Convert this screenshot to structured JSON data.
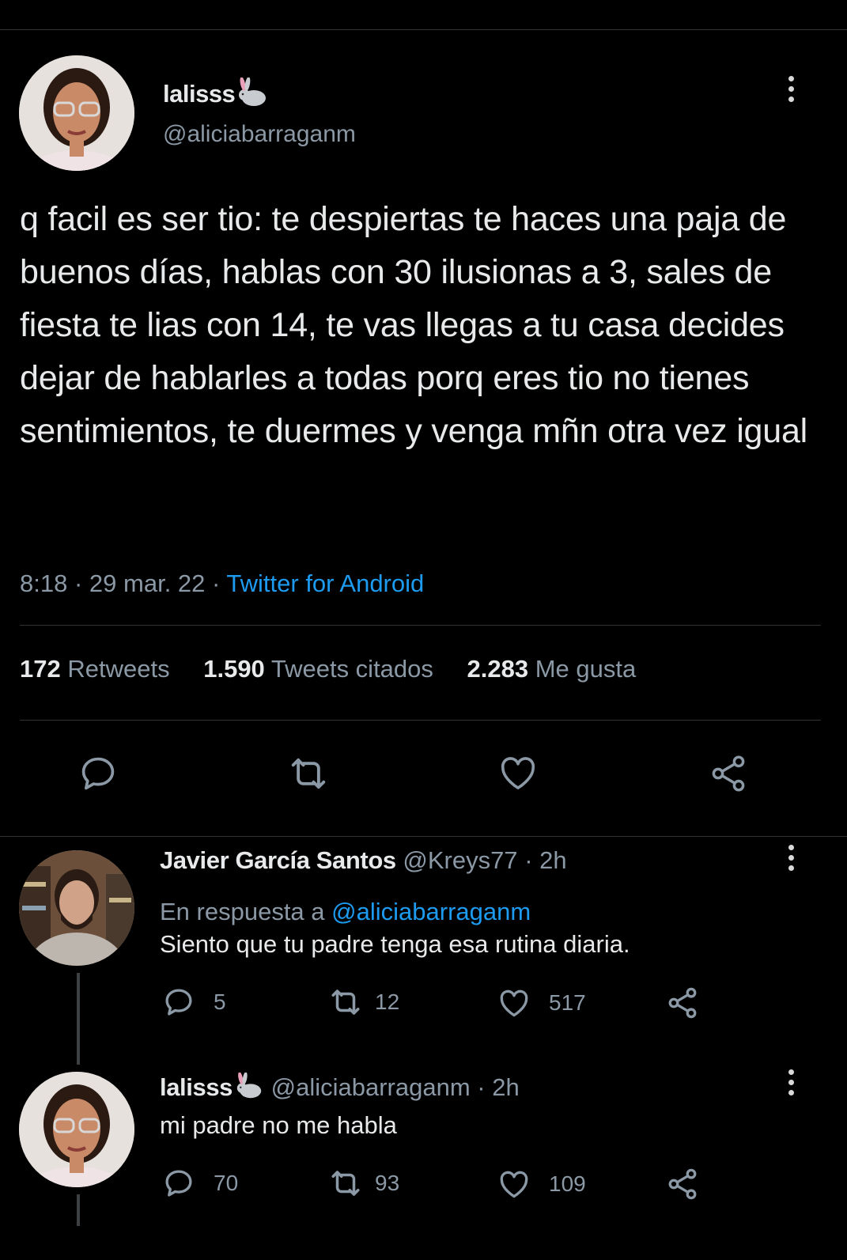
{
  "tweet": {
    "display_name": "lalisss",
    "name_emoji": "rabbit-icon",
    "handle": "@aliciabarraganm",
    "text": "q facil es ser tio: te despiertas te haces una paja de buenos días, hablas con 30 ilusionas a 3, sales de fiesta te lias con 14, te vas llegas a tu casa decides dejar de hablarles a todas porq eres tio no tienes sentimientos, te duermes y venga mñn otra vez igual",
    "time": "8:18",
    "date": "29 mar. 22",
    "sep": "·",
    "source": "Twitter for Android",
    "stats": {
      "retweets_count": "172",
      "retweets_label": "Retweets",
      "quotes_count": "1.590",
      "quotes_label": "Tweets citados",
      "likes_count": "2.283",
      "likes_label": "Me gusta"
    }
  },
  "replies": [
    {
      "display_name": "Javier García Santos",
      "handle": "@Kreys77",
      "time": "· 2h",
      "replying_prefix": "En respuesta a",
      "replying_to": "@aliciabarraganm",
      "text": "Siento que tu padre tenga esa rutina diaria.",
      "reply_count": "5",
      "retweet_count": "12",
      "like_count": "517"
    },
    {
      "display_name": "lalisss",
      "name_emoji": "rabbit-icon",
      "handle": "@aliciabarraganm",
      "time": "· 2h",
      "text": "mi padre no me habla",
      "reply_count": "70",
      "retweet_count": "93",
      "like_count": "109"
    }
  ],
  "colors": {
    "background": "#000000",
    "text": "#e7e9ea",
    "secondary": "#8b98a5",
    "link": "#1d9bf0",
    "divider": "#2f3336"
  }
}
